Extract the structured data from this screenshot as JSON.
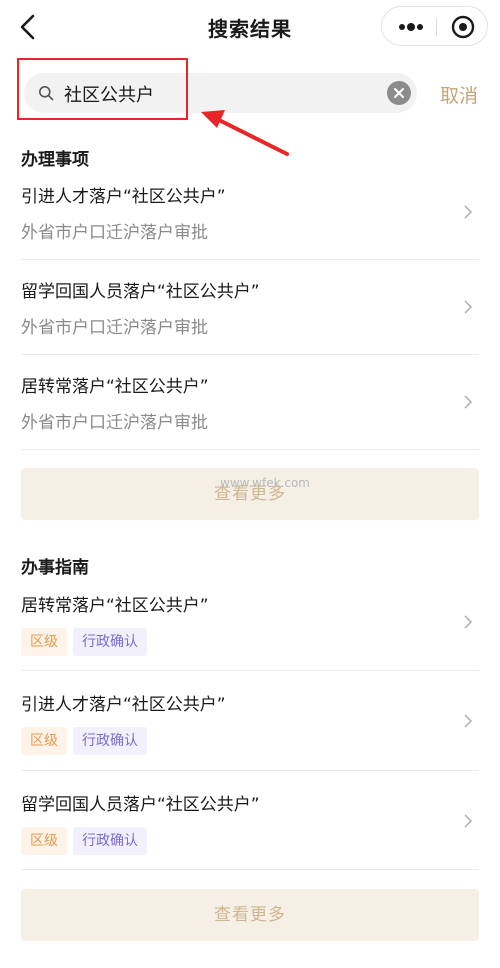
{
  "nav": {
    "title": "搜索结果"
  },
  "search": {
    "query": "社区公共户",
    "cancel_label": "取消"
  },
  "affairs": {
    "section_title": "办理事项",
    "items": [
      {
        "title": "引进人才落户“社区公共户”",
        "subtitle": "外省市户口迁沪落户审批"
      },
      {
        "title": "留学回国人员落户“社区公共户”",
        "subtitle": "外省市户口迁沪落户审批"
      },
      {
        "title": "居转常落户“社区公共户”",
        "subtitle": "外省市户口迁沪落户审批"
      }
    ],
    "more_label": "查看更多"
  },
  "watermark": "www.wfek.com",
  "guides": {
    "section_title": "办事指南",
    "items": [
      {
        "title": "居转常落户“社区公共户”",
        "tags": [
          "区级",
          "行政确认"
        ]
      },
      {
        "title": "引进人才落户“社区公共户”",
        "tags": [
          "区级",
          "行政确认"
        ]
      },
      {
        "title": "留学回国人员落户“社区公共户”",
        "tags": [
          "区级",
          "行政确认"
        ]
      }
    ],
    "more_label": "查看更多"
  },
  "colors": {
    "accent": "#c5a578",
    "annotation": "#e8262a",
    "tag_level": "#e49a4e",
    "tag_type": "#7a6dd0"
  }
}
